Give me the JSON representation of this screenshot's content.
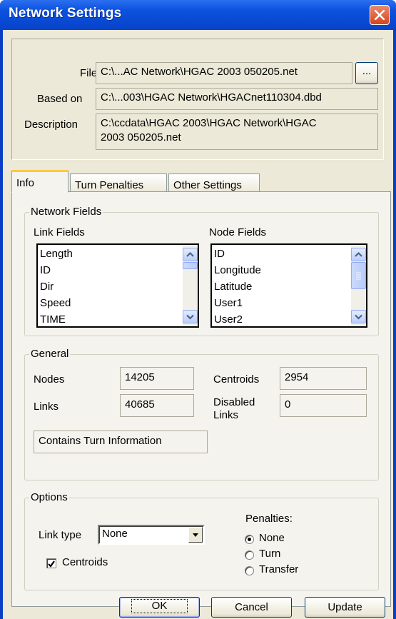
{
  "window": {
    "title": "Network Settings"
  },
  "file_info": {
    "file_label": "File",
    "file_value": "C:\\...AC Network\\HGAC 2003 050205.net",
    "browse_label": "...",
    "based_on_label": "Based on",
    "based_on_value": "C:\\...003\\HGAC Network\\HGACnet110304.dbd",
    "description_label": "Description",
    "description_line1": "C:\\ccdata\\HGAC 2003\\HGAC Network\\HGAC",
    "description_line2": "2003 050205.net"
  },
  "tabs": [
    {
      "label": "Info",
      "active": true
    },
    {
      "label": "Turn Penalties",
      "active": false
    },
    {
      "label": "Other Settings",
      "active": false
    }
  ],
  "network_fields": {
    "legend": "Network Fields",
    "link_fields_label": "Link Fields",
    "link_fields": [
      "Length",
      "ID",
      "Dir",
      "Speed",
      "TIME"
    ],
    "node_fields_label": "Node Fields",
    "node_fields": [
      "ID",
      "Longitude",
      "Latitude",
      "User1",
      "User2"
    ]
  },
  "general": {
    "legend": "General",
    "nodes_label": "Nodes",
    "nodes_value": "14205",
    "links_label": "Links",
    "links_value": "40685",
    "centroids_label": "Centroids",
    "centroids_value": "2954",
    "disabled_links_label_1": "Disabled",
    "disabled_links_label_2": "Links",
    "disabled_links_value": "0",
    "turn_info": "Contains Turn Information"
  },
  "options": {
    "legend": "Options",
    "link_type_label": "Link type",
    "link_type_value": "None",
    "penalties_label": "Penalties:",
    "penalty_options": [
      "None",
      "Turn",
      "Transfer"
    ],
    "penalty_selected": "None",
    "centroids_label": "Centroids",
    "centroids_checked": true
  },
  "buttons": {
    "ok": "OK",
    "cancel": "Cancel",
    "update": "Update"
  }
}
